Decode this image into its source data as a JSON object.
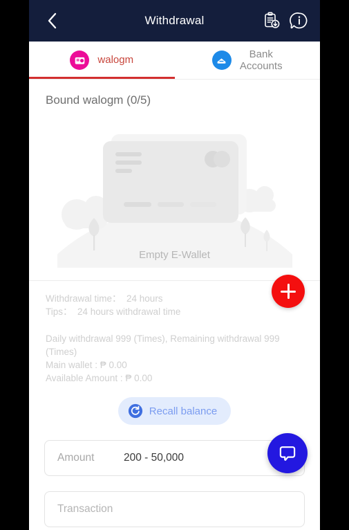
{
  "header": {
    "title": "Withdrawal",
    "back_icon": "chevron-left-icon",
    "actions": [
      {
        "icon": "clipboard-download-icon"
      },
      {
        "icon": "info-speech-bubble-icon"
      }
    ]
  },
  "tabs": [
    {
      "label": "walogm",
      "icon": "wallet-icon",
      "icon_color": "#ec0d98",
      "active": true
    },
    {
      "label": "Bank\nAccounts",
      "label_line1": "Bank",
      "label_line2": "Accounts",
      "icon": "bank-card-icon",
      "icon_color": "#1d8ae8",
      "active": false
    }
  ],
  "bound": {
    "title": "Bound walogm (0/5)"
  },
  "empty_state": {
    "label": "Empty E-Wallet",
    "illustration": "empty-ewallet-illustration"
  },
  "add_button": {
    "icon": "plus-icon",
    "color": "#f40f0f"
  },
  "info": {
    "withdrawal_time": "Withdrawal time：  24 hours",
    "tips": "Tips：  24 hours withdrawal time",
    "daily": "Daily withdrawal 999 (Times), Remaining withdrawal 999 (Times)",
    "main_wallet": "Main wallet : ₱ 0.00",
    "available_amount": "Available Amount : ₱ 0.00"
  },
  "recall": {
    "label": "Recall balance",
    "icon": "refresh-circle-icon"
  },
  "form": {
    "amount": {
      "label": "Amount",
      "value": "200 - 50,000"
    },
    "transaction": {
      "label": "Transaction"
    }
  },
  "chat": {
    "icon": "chat-bubble-icon",
    "color": "#2318e0"
  }
}
